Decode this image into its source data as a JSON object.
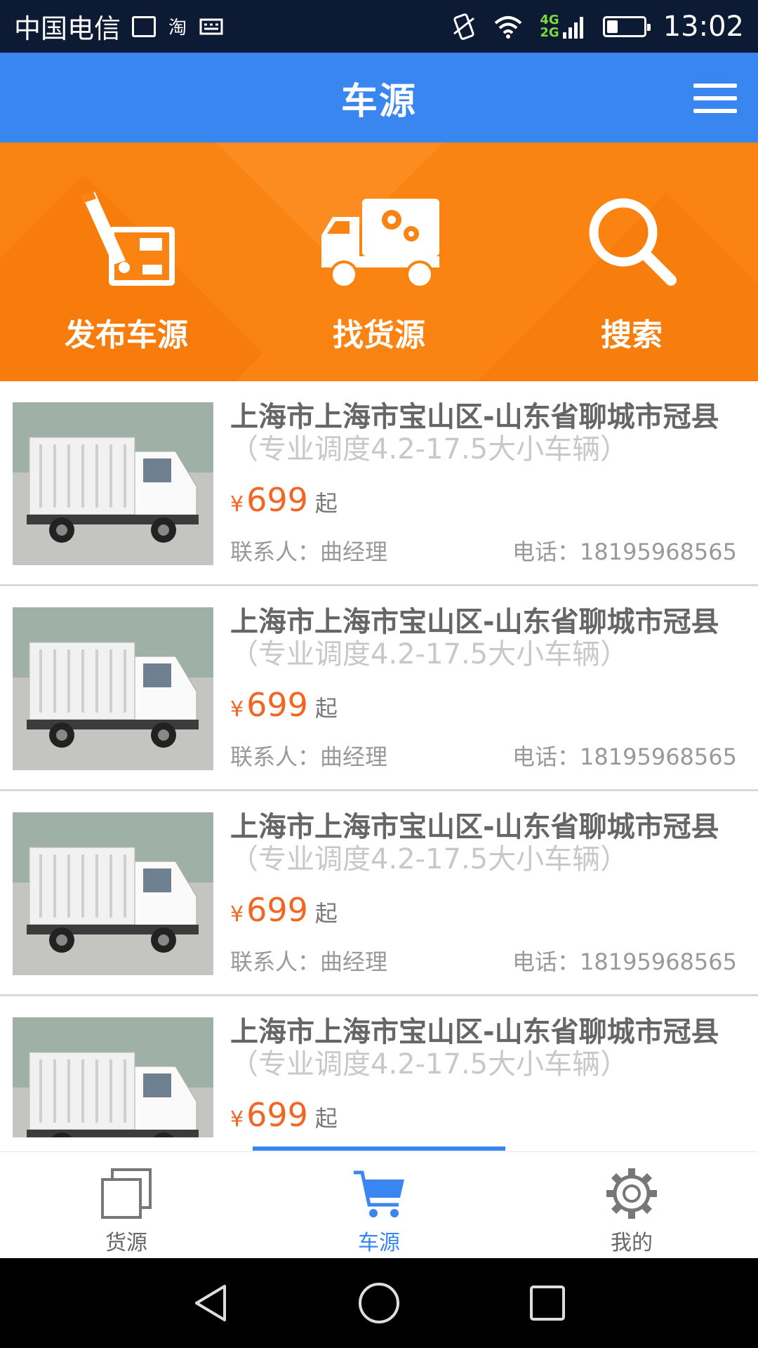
{
  "status_bar": {
    "carrier": "中国电信",
    "app_icon_text": "淘",
    "net_top": "4G",
    "net_bottom": "2G",
    "time": "13:02",
    "battery_level": 0.3
  },
  "header": {
    "title": "车源"
  },
  "actions": [
    {
      "label": "发布车源",
      "icon": "publish-icon"
    },
    {
      "label": "找货源",
      "icon": "truck-gears-icon"
    },
    {
      "label": "搜索",
      "icon": "search-icon"
    }
  ],
  "listings": [
    {
      "route": "上海市上海市宝山区-山东省聊城市冠县",
      "note": "（专业调度4.2-17.5大小车辆）",
      "currency": "¥",
      "price": "699",
      "price_suffix": "起",
      "contact": "联系人：曲经理",
      "phone": "电话：18195968565"
    },
    {
      "route": "上海市上海市宝山区-山东省聊城市冠县",
      "note": "（专业调度4.2-17.5大小车辆）",
      "currency": "¥",
      "price": "699",
      "price_suffix": "起",
      "contact": "联系人：曲经理",
      "phone": "电话：18195968565"
    },
    {
      "route": "上海市上海市宝山区-山东省聊城市冠县",
      "note": "（专业调度4.2-17.5大小车辆）",
      "currency": "¥",
      "price": "699",
      "price_suffix": "起",
      "contact": "联系人：曲经理",
      "phone": "电话：18195968565"
    },
    {
      "route": "上海市上海市宝山区-山东省聊城市冠县",
      "note": "（专业调度4.2-17.5大小车辆）",
      "currency": "¥",
      "price": "699",
      "price_suffix": "起",
      "contact": "",
      "phone": ""
    }
  ],
  "tabs": [
    {
      "label": "货源",
      "icon": "stack-icon",
      "active": false
    },
    {
      "label": "车源",
      "icon": "cart-icon",
      "active": true
    },
    {
      "label": "我的",
      "icon": "gear-icon",
      "active": false
    }
  ],
  "colors": {
    "header_blue": "#3a86f0",
    "action_orange": "#fb8311",
    "price_orange": "#f26522",
    "status_bar": "#0d1a33"
  }
}
